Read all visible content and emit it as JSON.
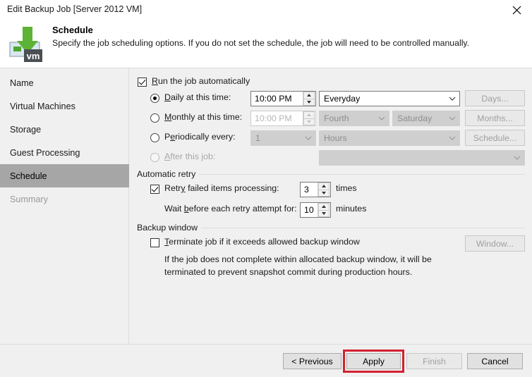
{
  "window": {
    "title": "Edit Backup Job [Server 2012 VM]",
    "close_icon": "close-icon"
  },
  "header": {
    "icon": "veeam-vm-backup-icon",
    "title": "Schedule",
    "subtitle": "Specify the job scheduling options. If you do not set the schedule, the job will need to be controlled manually."
  },
  "sidebar": {
    "items": [
      {
        "label": "Name",
        "state": "enabled"
      },
      {
        "label": "Virtual Machines",
        "state": "enabled"
      },
      {
        "label": "Storage",
        "state": "enabled"
      },
      {
        "label": "Guest Processing",
        "state": "enabled"
      },
      {
        "label": "Schedule",
        "state": "selected"
      },
      {
        "label": "Summary",
        "state": "disabled"
      }
    ]
  },
  "main": {
    "run_automatically": {
      "label": "Run the job automatically",
      "checked": true
    },
    "daily": {
      "label": "Daily at this time:",
      "selected": true,
      "time": "10:00 PM",
      "frequency": "Everyday",
      "button": "Days..."
    },
    "monthly": {
      "label": "Monthly at this time:",
      "selected": false,
      "time": "10:00 PM",
      "week": "Fourth",
      "day": "Saturday",
      "button": "Months..."
    },
    "periodically": {
      "label": "Periodically every:",
      "selected": false,
      "count": "1",
      "unit": "Hours",
      "button": "Schedule..."
    },
    "after_job": {
      "label": "After this job:",
      "selected": false,
      "value": ""
    },
    "automatic_retry": {
      "group_label": "Automatic retry",
      "retry_failed": {
        "label": "Retry failed items processing:",
        "checked": true,
        "value": "3",
        "unit": "times"
      },
      "wait_before": {
        "label": "Wait before each retry attempt for:",
        "value": "10",
        "unit": "minutes"
      }
    },
    "backup_window": {
      "group_label": "Backup window",
      "terminate": {
        "label": "Terminate job if it exceeds allowed backup window",
        "checked": false
      },
      "description_line1": "If the job does not complete within allocated backup window, it will be",
      "description_line2": "terminated to prevent snapshot commit during production hours.",
      "button": "Window..."
    }
  },
  "footer": {
    "previous": "< Previous",
    "apply": "Apply",
    "finish": "Finish",
    "cancel": "Cancel",
    "highlight_color": "#d42030"
  }
}
